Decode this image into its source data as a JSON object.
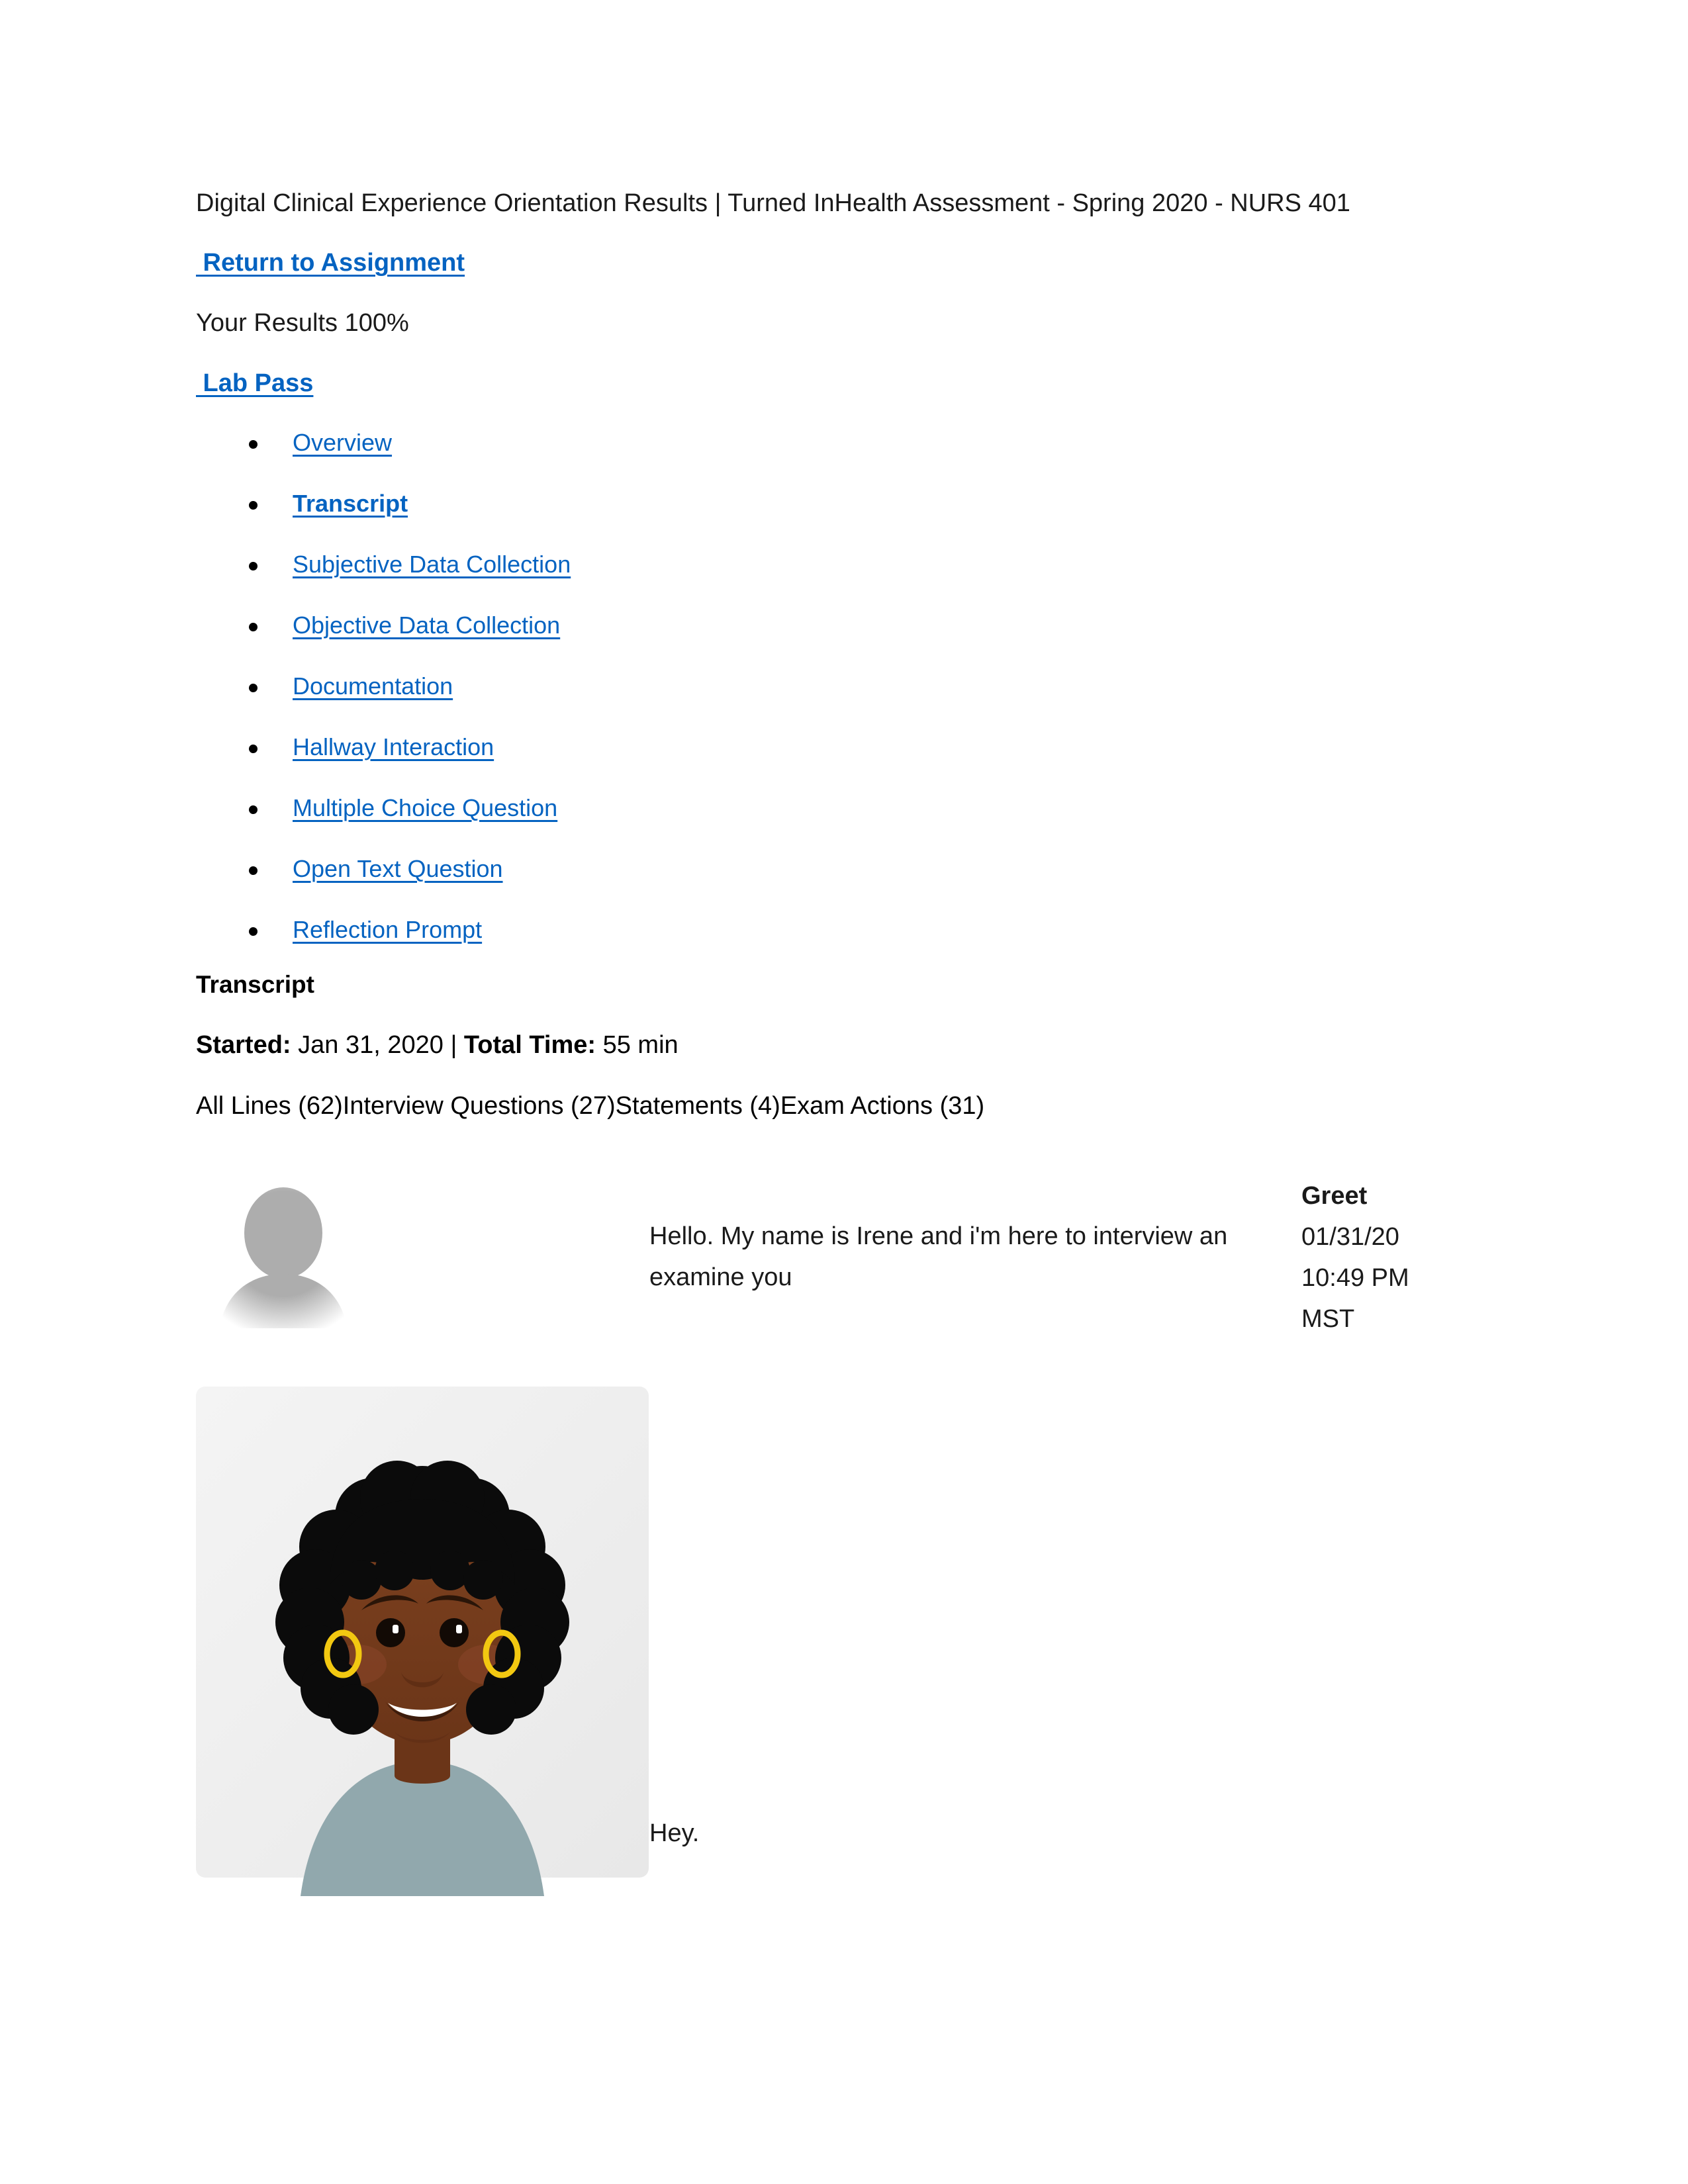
{
  "document": {
    "title_line": "Digital Clinical Experience Orientation Results | Turned InHealth Assessment - Spring 2020 - NURS 401",
    "return_link": " Return to Assignment",
    "results_line": "Your Results 100%",
    "lab_pass_link": " Lab Pass"
  },
  "nav": {
    "items": [
      {
        "label": "Overview",
        "active": false
      },
      {
        "label": "Transcript",
        "active": true
      },
      {
        "label": "Subjective Data Collection",
        "active": false
      },
      {
        "label": "Objective Data Collection",
        "active": false
      },
      {
        "label": "Documentation",
        "active": false
      },
      {
        "label": "Hallway Interaction",
        "active": false
      },
      {
        "label": "Multiple Choice Question",
        "active": false
      },
      {
        "label": "Open Text Question",
        "active": false
      },
      {
        "label": "Reflection Prompt",
        "active": false
      }
    ]
  },
  "transcript_section": {
    "heading": "Transcript",
    "started_label": "Started:",
    "started_value": " Jan 31, 2020 ",
    "separator": "| ",
    "total_time_label": "Total Time:",
    "total_time_value": " 55 min",
    "filters_line": "All Lines (62)Interview Questions (27)Statements (4)Exam Actions (31)",
    "filters": [
      {
        "label": "All Lines",
        "count": "(62)"
      },
      {
        "label": "Interview Questions",
        "count": "(27)"
      },
      {
        "label": "Statements",
        "count": "(4)"
      },
      {
        "label": "Exam Actions",
        "count": "(31)"
      }
    ]
  },
  "messages": [
    {
      "speaker": "examiner",
      "avatar": "placeholder-avatar-icon",
      "text": "Hello. My name is Irene and i'm here to interview an examine you",
      "action_label": "Greet",
      "timestamp_date": "01/31/20",
      "timestamp_time": "10:49 PM",
      "timestamp_zone": "MST"
    },
    {
      "speaker": "patient",
      "avatar": "patient-avatar-illustration",
      "text": "Hey."
    }
  ],
  "colors": {
    "link": "#0563C1",
    "text": "#1a1a1a",
    "page_background": "#ffffff",
    "avatar_card_background": "#F0F0F0",
    "patient_skin": "#7A3E1E",
    "patient_hair": "#0B0B0B",
    "patient_shirt": "#91A8AD",
    "earring_gold": "#F2C811",
    "placeholder_grey": "#ADADAD"
  }
}
